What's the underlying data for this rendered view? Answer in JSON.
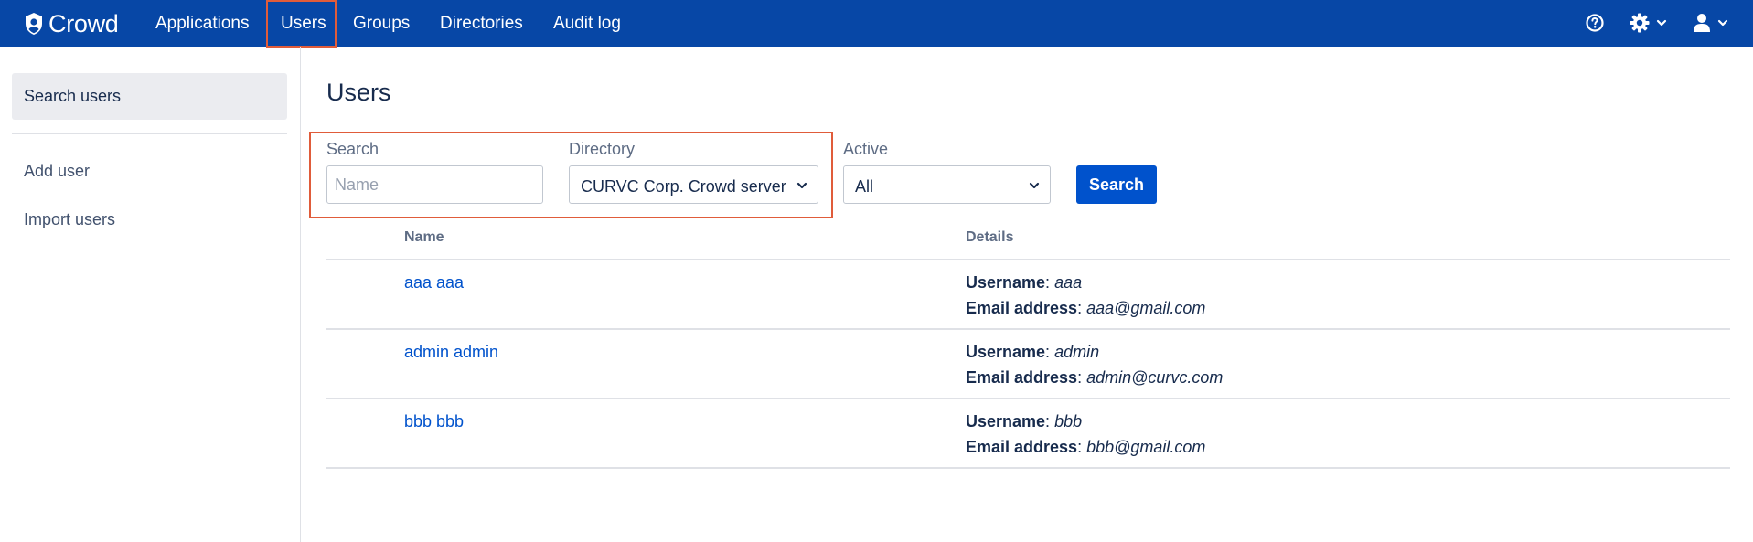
{
  "header": {
    "app_name": "Crowd",
    "nav": [
      {
        "label": "Applications"
      },
      {
        "label": "Users"
      },
      {
        "label": "Groups"
      },
      {
        "label": "Directories"
      },
      {
        "label": "Audit log"
      }
    ],
    "active_nav": "Users",
    "icons": [
      "help-icon",
      "settings-icon",
      "user-profile-icon"
    ],
    "color": "#0747a6"
  },
  "sidebar": {
    "items": [
      {
        "label": "Search users"
      },
      {
        "label": "Add user"
      },
      {
        "label": "Import users"
      }
    ],
    "active": "Search users"
  },
  "main": {
    "title": "Users",
    "filters": {
      "search_label": "Search",
      "search_placeholder": "Name",
      "search_value": "",
      "directory_label": "Directory",
      "directory_value": "CURVC Corp. Crowd server",
      "active_label": "Active",
      "active_value": "All",
      "search_button": "Search"
    },
    "table": {
      "columns": [
        "Name",
        "Details"
      ],
      "username_label": "Username",
      "email_label": "Email address",
      "rows": [
        {
          "name": "aaa aaa",
          "username": "aaa",
          "email": "aaa@gmail.com"
        },
        {
          "name": "admin admin",
          "username": "admin",
          "email": "admin@curvc.com"
        },
        {
          "name": "bbb bbb",
          "username": "bbb",
          "email": "bbb@gmail.com"
        }
      ]
    }
  }
}
